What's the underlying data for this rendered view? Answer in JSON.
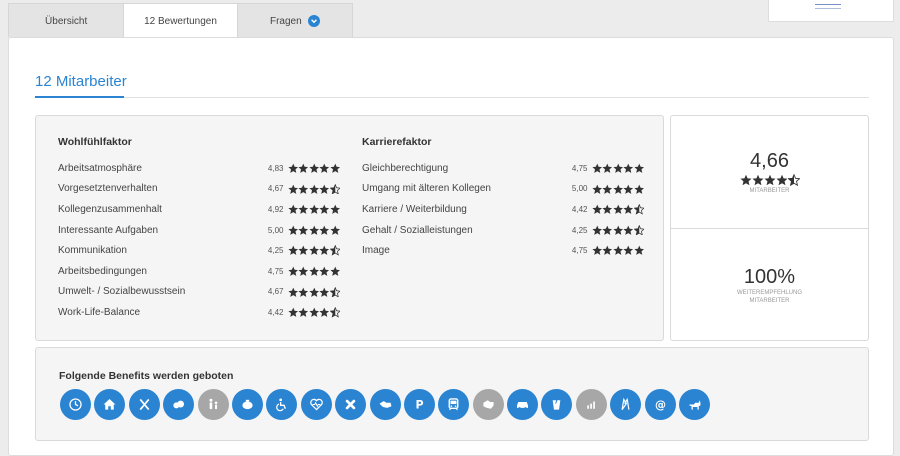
{
  "tabs": [
    {
      "label": "Übersicht"
    },
    {
      "label": "12 Bewertungen"
    },
    {
      "label": "Fragen"
    }
  ],
  "section_title": "12 Mitarbeiter",
  "wohlfuehl": {
    "title": "Wohlfühlfaktor",
    "rows": [
      {
        "label": "Arbeitsatmosphäre",
        "value": "4,83",
        "stars": 5
      },
      {
        "label": "Vorgesetztenverhalten",
        "value": "4,67",
        "stars": 4.5
      },
      {
        "label": "Kollegenzusammenhalt",
        "value": "4,92",
        "stars": 5
      },
      {
        "label": "Interessante Aufgaben",
        "value": "5,00",
        "stars": 5
      },
      {
        "label": "Kommunikation",
        "value": "4,25",
        "stars": 4.5
      },
      {
        "label": "Arbeitsbedingungen",
        "value": "4,75",
        "stars": 5
      },
      {
        "label": "Umwelt- / Sozialbewusstsein",
        "value": "4,67",
        "stars": 4.5
      },
      {
        "label": "Work-Life-Balance",
        "value": "4,42",
        "stars": 4.5
      }
    ]
  },
  "karriere": {
    "title": "Karrierefaktor",
    "rows": [
      {
        "label": "Gleichberechtigung",
        "value": "4,75",
        "stars": 5
      },
      {
        "label": "Umgang mit älteren Kollegen",
        "value": "5,00",
        "stars": 5
      },
      {
        "label": "Karriere / Weiterbildung",
        "value": "4,42",
        "stars": 4.5
      },
      {
        "label": "Gehalt / Sozialleistungen",
        "value": "4,25",
        "stars": 4.5
      },
      {
        "label": "Image",
        "value": "4,75",
        "stars": 5
      }
    ]
  },
  "summary": {
    "score": "4,66",
    "score_stars": 4.5,
    "score_label": "MITARBEITER",
    "recommend": "100%",
    "recommend_label_1": "WEITEREMPFEHLUNG",
    "recommend_label_2": "MITARBEITER"
  },
  "benefits": {
    "title": "Folgende Benefits werden geboten",
    "items": [
      {
        "icon": "flexible-hours-icon",
        "available": true
      },
      {
        "icon": "home-office-icon",
        "available": true
      },
      {
        "icon": "canteen-icon",
        "available": true
      },
      {
        "icon": "meal-vouchers-icon",
        "available": true
      },
      {
        "icon": "childcare-icon",
        "available": false
      },
      {
        "icon": "pension-icon",
        "available": true
      },
      {
        "icon": "accessibility-icon",
        "available": true
      },
      {
        "icon": "health-icon",
        "available": true
      },
      {
        "icon": "medical-icon",
        "available": true
      },
      {
        "icon": "employee-discount-icon",
        "available": true
      },
      {
        "icon": "parking-icon",
        "available": true
      },
      {
        "icon": "public-transport-icon",
        "available": true
      },
      {
        "icon": "coaching-icon",
        "available": false
      },
      {
        "icon": "company-car-icon",
        "available": true
      },
      {
        "icon": "drinks-icon",
        "available": true
      },
      {
        "icon": "profit-sharing-icon",
        "available": false
      },
      {
        "icon": "events-icon",
        "available": true
      },
      {
        "icon": "internet-icon",
        "available": true
      },
      {
        "icon": "pets-icon",
        "available": true
      }
    ]
  },
  "colors": {
    "accent": "#2a84d2",
    "inactive": "#a7a7a7",
    "star": "#333333"
  }
}
